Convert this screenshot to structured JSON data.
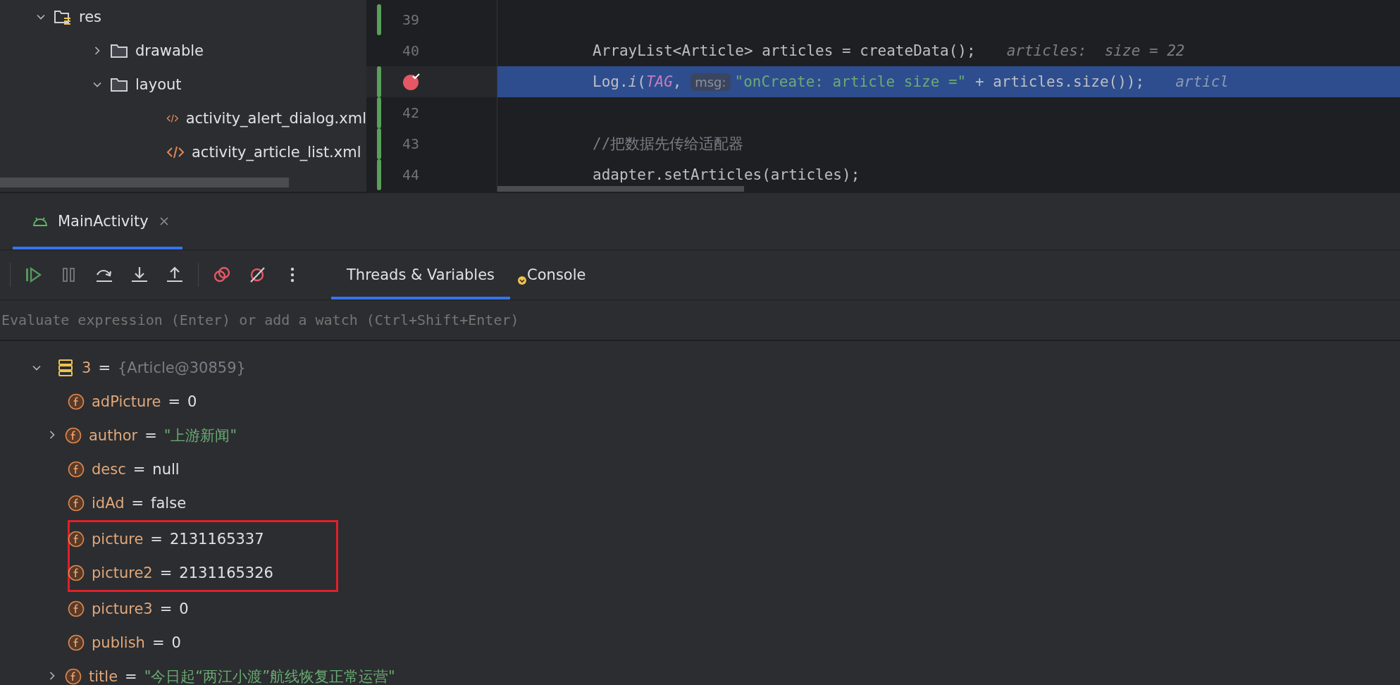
{
  "project_tree": [
    {
      "name": "res",
      "kind": "resources",
      "expanded": true,
      "children": [
        {
          "name": "drawable",
          "kind": "folder",
          "expanded": false
        },
        {
          "name": "layout",
          "kind": "folder",
          "expanded": true,
          "children": [
            {
              "name": "activity_alert_dialog.xml",
              "kind": "xml"
            },
            {
              "name": "activity_article_list.xml",
              "kind": "xml"
            }
          ]
        }
      ]
    }
  ],
  "editor": {
    "lines": [
      {
        "number": "39",
        "changed": true,
        "breakpoint": false,
        "selected": false
      },
      {
        "number": "40",
        "changed": false,
        "breakpoint": false,
        "selected": false,
        "tokens": [
          {
            "text": "ArrayList<Article> articles = createData();",
            "kind": "plain"
          }
        ],
        "hint": "articles:  size = 22"
      },
      {
        "changed": true,
        "breakpoint": true,
        "selected": true,
        "tokens": [
          {
            "text": "Log.",
            "kind": "plain"
          },
          {
            "text": "i",
            "kind": "italic"
          },
          {
            "text": "(",
            "kind": "plain"
          },
          {
            "text": "TAG",
            "kind": "constant"
          },
          {
            "text": ", ",
            "kind": "plain"
          },
          {
            "text": "msg:",
            "kind": "param_hint"
          },
          {
            "text": "\"onCreate: article size =\"",
            "kind": "string"
          },
          {
            "text": " + articles.size());",
            "kind": "plain"
          }
        ],
        "hint": "articl"
      },
      {
        "number": "42",
        "changed": true,
        "breakpoint": false,
        "selected": false
      },
      {
        "number": "43",
        "changed": true,
        "breakpoint": false,
        "selected": false,
        "tokens": [
          {
            "text": "//把数据先传给适配器",
            "kind": "comment"
          }
        ]
      },
      {
        "number": "44",
        "changed": true,
        "breakpoint": false,
        "selected": false,
        "tokens": [
          {
            "text": "adapter.setArticles(articles);",
            "kind": "plain"
          }
        ]
      }
    ]
  },
  "debug": {
    "session_tab": {
      "label": "MainActivity",
      "selected": true
    },
    "toolbar": [
      {
        "kind": "resume",
        "disabled": false
      },
      {
        "kind": "pause",
        "disabled": true
      },
      {
        "kind": "step_over",
        "disabled": false
      },
      {
        "kind": "step_into",
        "disabled": false
      },
      {
        "kind": "step_out",
        "disabled": false
      },
      {
        "kind": "view_breakpoints",
        "disabled": false
      },
      {
        "kind": "mute_breakpoints",
        "disabled": false
      },
      {
        "kind": "more",
        "disabled": false
      }
    ],
    "tabs": [
      {
        "label": "Threads & Variables",
        "selected": true,
        "badge": false
      },
      {
        "label": "Console",
        "selected": false,
        "badge": true
      }
    ],
    "evaluate": {
      "placeholder": "Evaluate expression (Enter) or add a watch (Ctrl+Shift+Enter)"
    },
    "variables": {
      "name": "3",
      "operator": "=",
      "value": "{Article@30859}",
      "expanded": true,
      "children": [
        {
          "name": "adPicture",
          "operator": "=",
          "value": "0",
          "kind": "plain",
          "highlighted": false
        },
        {
          "name": "author",
          "operator": "=",
          "value": "\"上游新闻\"",
          "kind": "string",
          "expanded": false,
          "highlighted": false
        },
        {
          "name": "desc",
          "operator": "=",
          "value": "null",
          "kind": "plain",
          "highlighted": false
        },
        {
          "name": "idAd",
          "operator": "=",
          "value": "false",
          "kind": "plain",
          "highlighted": false
        },
        {
          "name": "picture",
          "operator": "=",
          "value": "2131165337",
          "kind": "plain",
          "highlighted": true
        },
        {
          "name": "picture2",
          "operator": "=",
          "value": "2131165326",
          "kind": "plain",
          "highlighted": true
        },
        {
          "name": "picture3",
          "operator": "=",
          "value": "0",
          "kind": "plain",
          "highlighted": false
        },
        {
          "name": "publish",
          "operator": "=",
          "value": "0",
          "kind": "plain",
          "highlighted": false
        },
        {
          "name": "title",
          "operator": "=",
          "value": "\"今日起“两江小渡”航线恢复正常运营\"",
          "kind": "string",
          "expanded": false,
          "highlighted": false
        }
      ]
    }
  }
}
